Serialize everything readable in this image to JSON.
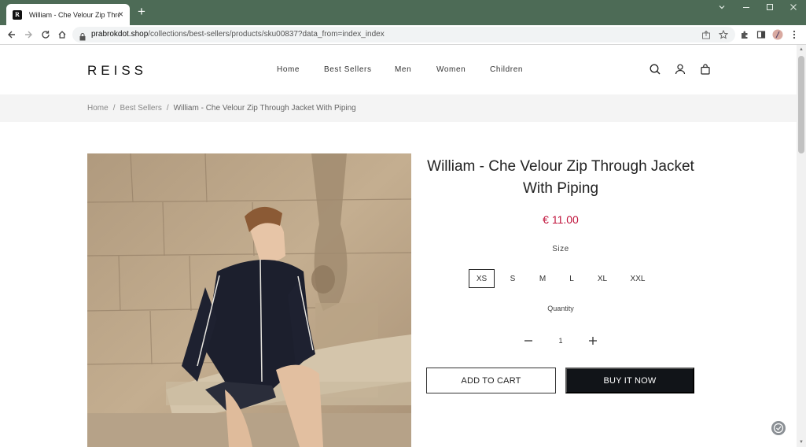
{
  "browser": {
    "tab_title": "William - Che Velour Zip Through",
    "favicon_letter": "R",
    "url_domain": "prabrokdot.shop",
    "url_path": "/collections/best-sellers/products/sku00837?data_from=index_index",
    "frame_color": "#4d6b56"
  },
  "header": {
    "logo": "REISS",
    "nav": [
      "Home",
      "Best Sellers",
      "Men",
      "Women",
      "Children"
    ],
    "icons": [
      "search-icon",
      "account-icon",
      "cart-icon"
    ]
  },
  "breadcrumb": {
    "items": [
      "Home",
      "Best Sellers"
    ],
    "current": "William - Che Velour Zip Through Jacket With Piping"
  },
  "product": {
    "title": "William - Che Velour Zip Through Jacket With Piping",
    "price": "€ 11.00",
    "price_color": "#c0143c",
    "size_label": "Size",
    "sizes": [
      "XS",
      "S",
      "M",
      "L",
      "XL",
      "XXL"
    ],
    "selected_size": "XS",
    "quantity_label": "Quantity",
    "quantity": "1",
    "add_to_cart": "ADD TO CART",
    "buy_now": "BUY IT NOW"
  }
}
